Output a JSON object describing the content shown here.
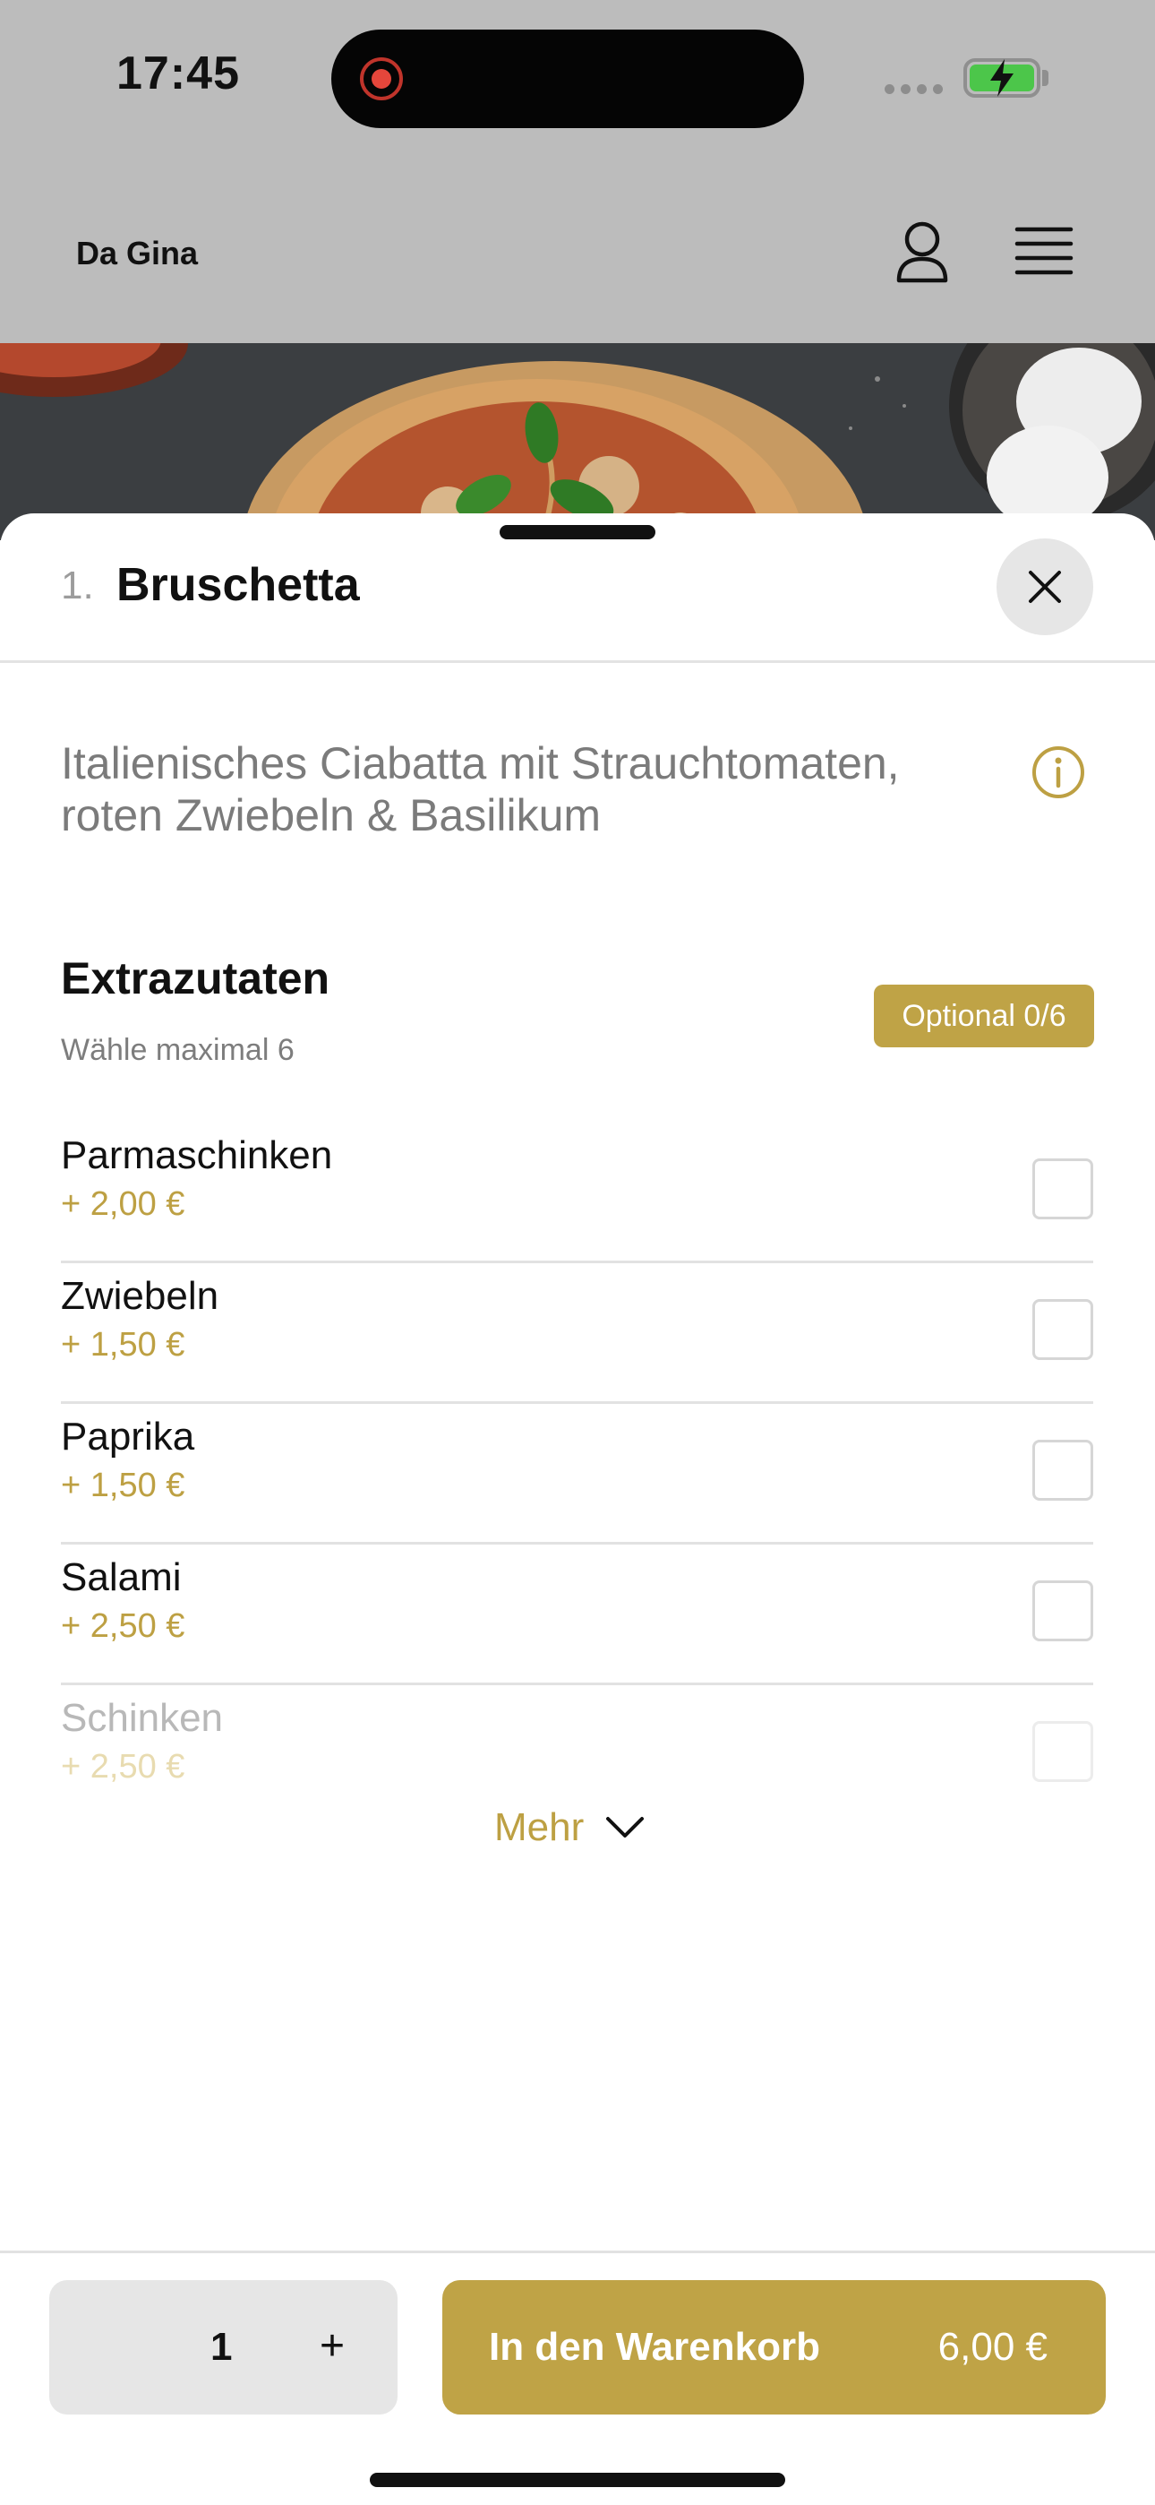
{
  "status_bar": {
    "time": "17:45"
  },
  "header": {
    "brand": "Da Gina"
  },
  "item": {
    "number": "1.",
    "title": "Bruschetta",
    "description": "Italienisches Ciabatta mit Strauchtomaten, roten Zwiebeln & Basilikum"
  },
  "extras": {
    "title": "Extrazutaten",
    "subtitle": "Wähle maximal 6",
    "badge": "Optional 0/6",
    "options": [
      {
        "name": "Parmaschinken",
        "price": "+ 2,00 €"
      },
      {
        "name": "Zwiebeln",
        "price": "+ 1,50 €"
      },
      {
        "name": "Paprika",
        "price": "+ 1,50 €"
      },
      {
        "name": "Salami",
        "price": "+ 2,50 €"
      },
      {
        "name": "Schinken",
        "price": "+ 2,50 €"
      }
    ],
    "more_label": "Mehr"
  },
  "footer": {
    "quantity": "1",
    "plus": "+",
    "cart_label": "In den Warenkorb",
    "cart_price": "6,00 €"
  },
  "colors": {
    "accent": "#bfa346",
    "overlay_grey": "#bcbcbc"
  },
  "icons": [
    "profile-icon",
    "menu-icon",
    "close-icon",
    "info-icon",
    "chevron-down-icon",
    "battery-icon",
    "record-icon"
  ]
}
